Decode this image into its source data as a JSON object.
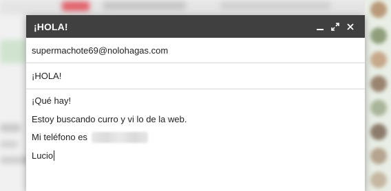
{
  "window": {
    "title": "¡HOLA!",
    "controls": {
      "minimize_icon": "minimize-icon",
      "expand_icon": "expand-icon",
      "close_icon": "close-icon"
    }
  },
  "compose": {
    "to": "supermachote69@nolohagas.com",
    "subject": "¡HOLA!",
    "body": {
      "line1": "¡Qué hay!",
      "line2": "Estoy buscando curro y vi lo de la web.",
      "line3_prefix": "Mi teléfono es",
      "line4": "Lucio"
    }
  },
  "colors": {
    "titlebar": "#404040",
    "background": "#f1f1f1"
  }
}
